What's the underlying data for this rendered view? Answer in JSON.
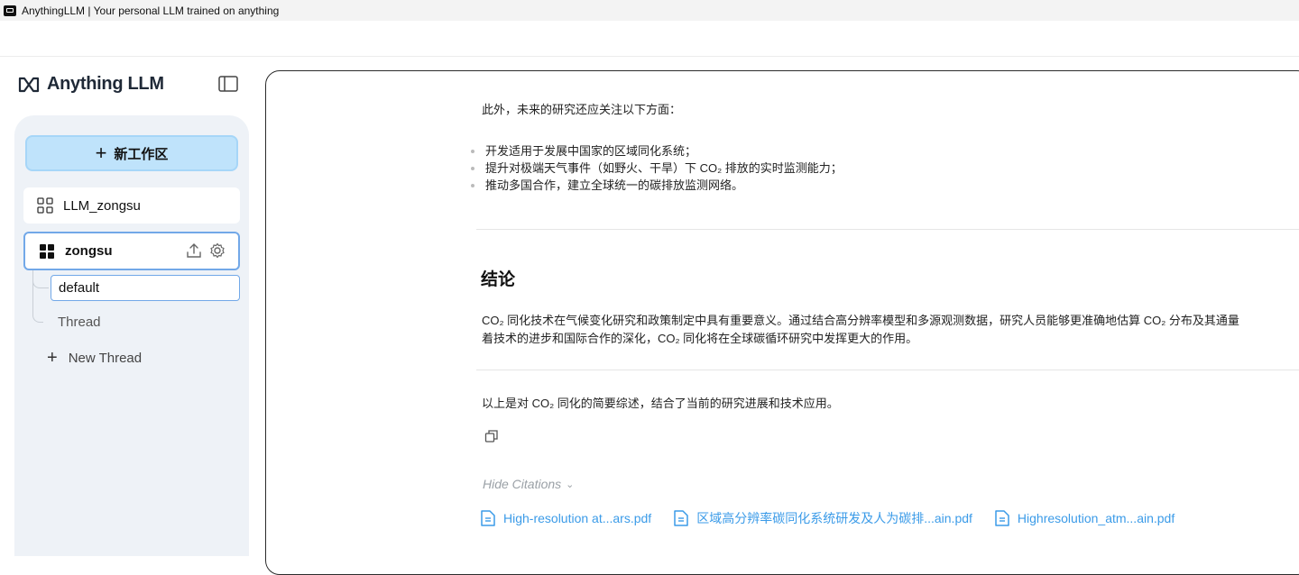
{
  "window": {
    "title": "AnythingLLM | Your personal LLM trained on anything"
  },
  "sidebar": {
    "logo_text": "Anything LLM",
    "new_workspace_label": "新工作区",
    "workspaces": [
      {
        "name": "LLM_zongsu"
      },
      {
        "name": "zongsu"
      }
    ],
    "threads": [
      {
        "name": "default"
      },
      {
        "name": "Thread"
      }
    ],
    "new_thread_label": "New Thread"
  },
  "chat": {
    "intro": "此外，未来的研究还应关注以下方面：",
    "bullets": [
      "开发适用于发展中国家的区域同化系统；",
      "提升对极端天气事件（如野火、干旱）下 CO₂ 排放的实时监测能力；",
      "推动多国合作，建立全球统一的碳排放监测网络。"
    ],
    "heading": "结论",
    "paragraph_line1": "CO₂ 同化技术在气候变化研究和政策制定中具有重要意义。通过结合高分辨率模型和多源观测数据，研究人员能够更准确地估算 CO₂ 分布及其通量",
    "paragraph_line2": "着技术的进步和国际合作的深化，CO₂ 同化将在全球碳循环研究中发挥更大的作用。",
    "summary": "以上是对 CO₂ 同化的简要综述，结合了当前的研究进展和技术应用。",
    "hide_citations_label": "Hide Citations",
    "citations": [
      "High-resolution at...ars.pdf",
      "区域高分辨率碳同化系统研发及人为碳排...ain.pdf",
      "Highresolution_atm...ain.pdf"
    ]
  },
  "colors": {
    "accent": "#3b9be8",
    "new_workspace_bg": "#bfe3fb",
    "active_border": "#72a8e8",
    "sidebar_bg": "#eef2f7"
  }
}
